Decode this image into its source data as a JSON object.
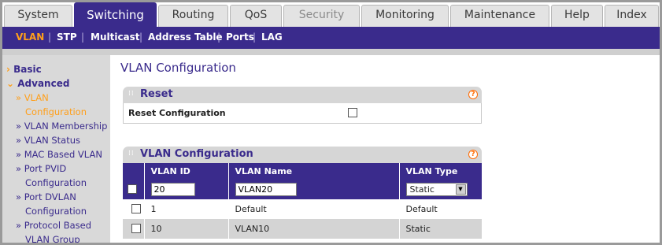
{
  "tabs": [
    {
      "label": "System"
    },
    {
      "label": "Switching"
    },
    {
      "label": "Routing"
    },
    {
      "label": "QoS"
    },
    {
      "label": "Security"
    },
    {
      "label": "Monitoring"
    },
    {
      "label": "Maintenance"
    },
    {
      "label": "Help"
    },
    {
      "label": "Index"
    }
  ],
  "subnav": [
    {
      "label": "VLAN"
    },
    {
      "label": "STP"
    },
    {
      "label": "Multicast"
    },
    {
      "label": "Address Table"
    },
    {
      "label": "Ports"
    },
    {
      "label": "LAG"
    }
  ],
  "leftnav": {
    "basic": "Basic",
    "advanced": "Advanced",
    "items": [
      {
        "label": "» VLAN"
      },
      {
        "label": "Configuration"
      },
      {
        "label": "» VLAN Membership"
      },
      {
        "label": "» VLAN Status"
      },
      {
        "label": "» MAC Based VLAN"
      },
      {
        "label": "» Port PVID"
      },
      {
        "label": "Configuration"
      },
      {
        "label": "» Port DVLAN"
      },
      {
        "label": "Configuration"
      },
      {
        "label": "» Protocol Based"
      },
      {
        "label": "VLAN Group"
      }
    ]
  },
  "page": {
    "title": "VLAN Configuration"
  },
  "reset_panel": {
    "title": "Reset",
    "label": "Reset Configuration",
    "help": "?"
  },
  "vlan_panel": {
    "title": "VLAN Configuration",
    "help": "?",
    "columns": [
      "VLAN ID",
      "VLAN Name",
      "VLAN Type"
    ],
    "edit_row": {
      "vlan_id": "20",
      "vlan_name": "VLAN20",
      "vlan_type": "Static"
    },
    "rows": [
      {
        "vlan_id": "1",
        "vlan_name": "Default",
        "vlan_type": "Default"
      },
      {
        "vlan_id": "10",
        "vlan_name": "VLAN10",
        "vlan_type": "Static"
      }
    ]
  },
  "colors": {
    "brand_purple": "#3a2b8c",
    "accent_orange": "#ff9f1a",
    "panel_gray": "#d6d6d6"
  },
  "icons": {
    "grip": "grip-dots-icon",
    "help": "help-icon",
    "dropdown": "dropdown-arrow-icon"
  }
}
